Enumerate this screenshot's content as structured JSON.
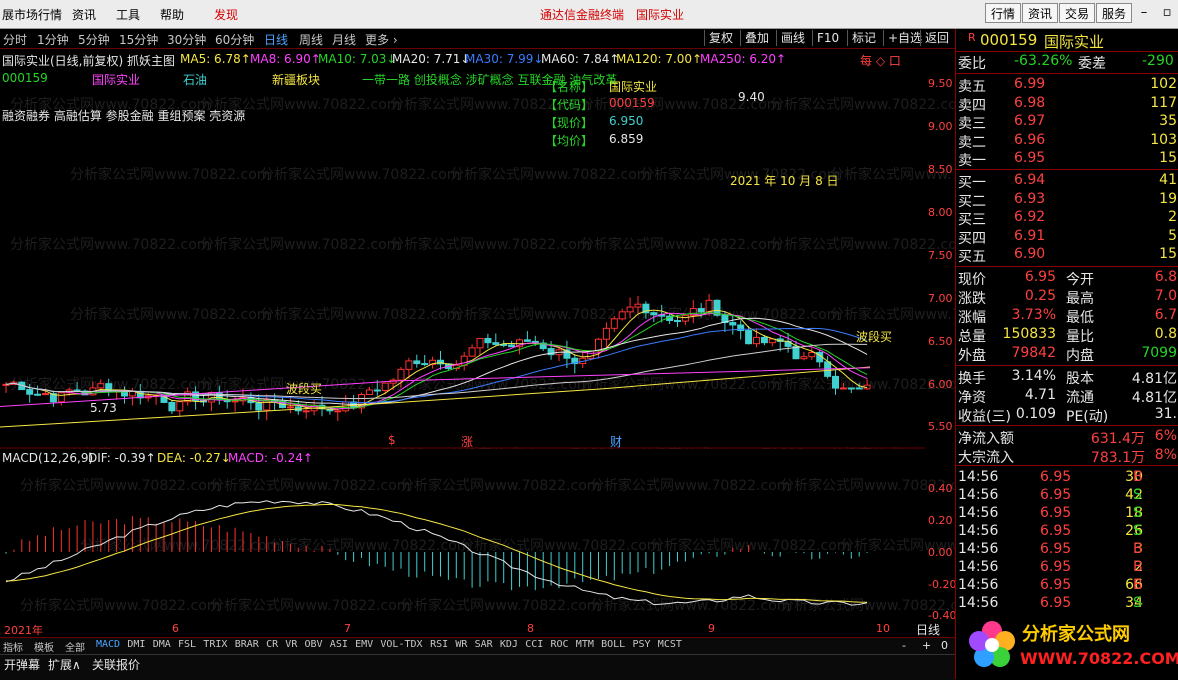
{
  "menubar": {
    "left_title": "展市场行情",
    "items": [
      "资讯",
      "工具",
      "帮助"
    ],
    "alert": "发现",
    "center_red": "通达信金融终端",
    "center_stock": "国际实业",
    "right_buttons": [
      "行情",
      "资讯",
      "交易",
      "服务"
    ]
  },
  "toolbar": {
    "periods": [
      "分时",
      "1分钟",
      "5分钟",
      "15分钟",
      "30分钟",
      "60分钟",
      "日线",
      "周线",
      "月线",
      "更多 ›"
    ],
    "active": "日线",
    "right": [
      "复权",
      "叠加",
      "画线",
      "F10",
      "标记",
      "+自选",
      "返回"
    ]
  },
  "chart_header": {
    "title": "国际实业(日线,前复权) 抓妖主图",
    "ma": [
      {
        "label": "MA5: 6.78↑",
        "color": "#f5e642"
      },
      {
        "label": "MA8: 6.90↑",
        "color": "#ff40ff"
      },
      {
        "label": "MA10: 7.03↓",
        "color": "#26d426"
      },
      {
        "label": "MA20: 7.71↓",
        "color": "#e6e6e6"
      },
      {
        "label": "MA30: 7.99↓",
        "color": "#3a7bff"
      },
      {
        "label": "MA60: 7.84↑",
        "color": "#e6e6e6"
      },
      {
        "label": "MA120: 7.00↑",
        "color": "#f5e642"
      },
      {
        "label": "MA250: 6.20↑",
        "color": "#ff40ff"
      }
    ],
    "right_mark": "每 ◇ 口",
    "code": "000159",
    "name": "国际实业",
    "industry": "石油",
    "region": "新疆板块",
    "concepts": "一带一路 创投概念 涉矿概念 互联金融 油气改革",
    "concepts2": "融资融券 高融估算 参股金融 重组预案 壳资源"
  },
  "info_box": {
    "name_label": "【名称】",
    "name_value": "国际实业",
    "code_label": "【代码】",
    "code_value": "000159",
    "price_label": "【现价】",
    "price_value": "6.950",
    "avg_label": "【均价】",
    "avg_value": "6.859"
  },
  "annotations": {
    "high": "9.40",
    "low": "5.73",
    "date_label": "2021 年 10 月 8 日",
    "buy1": "波段买",
    "buy2": "波段买",
    "m1": "$",
    "m2": "涨",
    "m3": "财"
  },
  "yaxis": [
    "9.50",
    "9.00",
    "8.50",
    "8.00",
    "7.50",
    "7.00",
    "6.50",
    "6.00",
    "5.50"
  ],
  "macd": {
    "title": "MACD(12,26,9)",
    "dif": "DIF: -0.39↑",
    "dea": "DEA: -0.27↓",
    "macd": "MACD: -0.24↑",
    "yaxis": [
      "0.40",
      "0.20",
      "0.00",
      "-0.20",
      "-0.40"
    ]
  },
  "xaxis": {
    "year": "2021年",
    "months": [
      "6",
      "7",
      "8",
      "9",
      "10"
    ]
  },
  "tabs": [
    "指标",
    "模板",
    "全部",
    "MACD",
    "DMI",
    "DMA",
    "FSL",
    "TRIX",
    "BRAR",
    "CR",
    "VR",
    "OBV",
    "ASI",
    "EMV",
    "VOL-TDX",
    "RSI",
    "WR",
    "SAR",
    "KDJ",
    "CCI",
    "ROC",
    "MTM",
    "BOLL",
    "PSY",
    "MCST"
  ],
  "tab_active": "MACD",
  "tabs_right": {
    "period": "日线",
    "minus": "-",
    "plus": "+",
    "zero": "0"
  },
  "bottombar": {
    "left": "开弹幕",
    "mid": "扩展∧",
    "right": "关联报价"
  },
  "quote": {
    "code": "000159",
    "name": "国际实业",
    "weibi_label": "委比",
    "weibi_value": "-63.26%",
    "weicha_label": "委差",
    "weicha_value": "-290",
    "asks": [
      {
        "label": "卖五",
        "price": "6.99",
        "vol": "102"
      },
      {
        "label": "卖四",
        "price": "6.98",
        "vol": "117"
      },
      {
        "label": "卖三",
        "price": "6.97",
        "vol": "35"
      },
      {
        "label": "卖二",
        "price": "6.96",
        "vol": "103"
      },
      {
        "label": "卖一",
        "price": "6.95",
        "vol": "15"
      }
    ],
    "bids": [
      {
        "label": "买一",
        "price": "6.94",
        "vol": "41"
      },
      {
        "label": "买二",
        "price": "6.93",
        "vol": "19"
      },
      {
        "label": "买三",
        "price": "6.92",
        "vol": "2"
      },
      {
        "label": "买四",
        "price": "6.91",
        "vol": "5"
      },
      {
        "label": "买五",
        "price": "6.90",
        "vol": "15"
      }
    ],
    "stats": [
      {
        "l1": "现价",
        "v1": "6.95",
        "c1": "red",
        "l2": "今开",
        "v2": "6.8",
        "c2": "red"
      },
      {
        "l1": "涨跌",
        "v1": "0.25",
        "c1": "red",
        "l2": "最高",
        "v2": "7.0",
        "c2": "red"
      },
      {
        "l1": "涨幅",
        "v1": "3.73%",
        "c1": "red",
        "l2": "最低",
        "v2": "6.7",
        "c2": "red"
      },
      {
        "l1": "总量",
        "v1": "150833",
        "c1": "yel",
        "l2": "量比",
        "v2": "0.8",
        "c2": "yel"
      },
      {
        "l1": "外盘",
        "v1": "79842",
        "c1": "red",
        "l2": "内盘",
        "v2": "7099",
        "c2": "grn"
      }
    ],
    "stats2": [
      {
        "l1": "换手",
        "v1": "3.14%",
        "l2": "股本",
        "v2": "4.81亿"
      },
      {
        "l1": "净资",
        "v1": "4.71",
        "l2": "流通",
        "v2": "4.81亿"
      },
      {
        "l1": "收益(三)",
        "v1": "0.109",
        "l2": "PE(动)",
        "v2": "31."
      }
    ],
    "flows": [
      {
        "label": "净流入额",
        "value": "631.4万",
        "pct": "6%"
      },
      {
        "label": "大宗流入",
        "value": "783.1万",
        "pct": "8%"
      }
    ],
    "ticks": [
      {
        "t": "14:56",
        "p": "6.95",
        "v": "30",
        "s": "B"
      },
      {
        "t": "14:56",
        "p": "6.95",
        "v": "42",
        "s": "S"
      },
      {
        "t": "14:56",
        "p": "6.95",
        "v": "18",
        "s": "S"
      },
      {
        "t": "14:56",
        "p": "6.95",
        "v": "26",
        "s": "S"
      },
      {
        "t": "14:56",
        "p": "6.95",
        "v": "3",
        "s": "B"
      },
      {
        "t": "14:56",
        "p": "6.95",
        "v": "2",
        "s": "B"
      },
      {
        "t": "14:56",
        "p": "6.95",
        "v": "66",
        "s": "B"
      },
      {
        "t": "14:56",
        "p": "6.95",
        "v": "34",
        "s": "S"
      }
    ],
    "ticks_extra": [
      "1",
      "1"
    ]
  },
  "logo": {
    "brand": "分析家公式网",
    "url": "WWW.70822.COM"
  },
  "watermark": "分析家公式网www.70822.com"
}
